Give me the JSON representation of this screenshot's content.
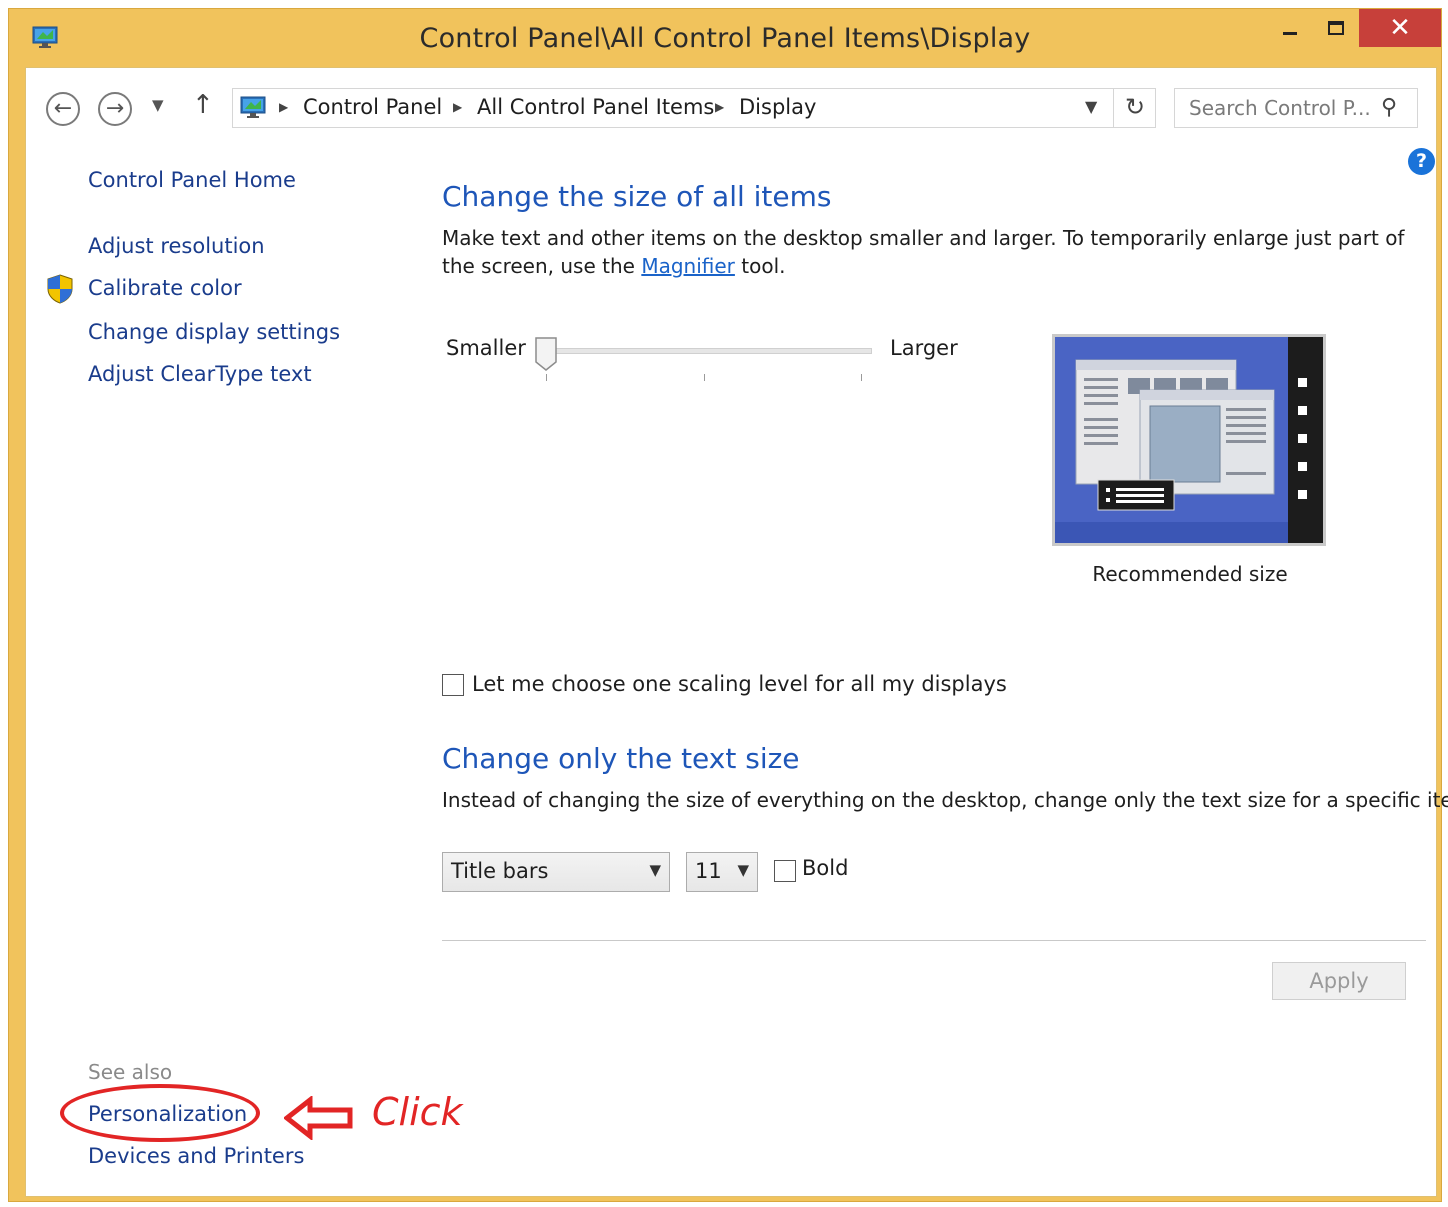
{
  "window": {
    "title": "Control Panel\\All Control Panel Items\\Display",
    "close_glyph": "✕"
  },
  "nav": {
    "breadcrumb": [
      "Control Panel",
      "All Control Panel Items",
      "Display"
    ],
    "search_placeholder": "Search Control P..."
  },
  "sidebar": {
    "home": "Control Panel Home",
    "links": [
      "Adjust resolution",
      "Calibrate color",
      "Change display settings",
      "Adjust ClearType text"
    ],
    "see_also_label": "See also",
    "see_also": [
      "Personalization",
      "Devices and Printers"
    ]
  },
  "annotation": {
    "text": "Click",
    "color": "#e22525"
  },
  "section_size": {
    "heading": "Change the size of all items",
    "desc_before": "Make text and other items on the desktop smaller and larger. To temporarily enlarge just part of the screen, use the ",
    "link": "Magnifier",
    "desc_after": " tool.",
    "slider_min_label": "Smaller",
    "slider_max_label": "Larger",
    "slider_level": 0,
    "preview_caption": "Recommended size"
  },
  "scaling_checkbox": {
    "label": "Let me choose one scaling level for all my displays",
    "checked": false
  },
  "section_text": {
    "heading": "Change only the text size",
    "desc": "Instead of changing the size of everything on the desktop, change only the text size for a specific item.",
    "item_selected": "Title bars",
    "size_selected": "11",
    "bold_label": "Bold",
    "bold_checked": false
  },
  "apply_label": "Apply",
  "colors": {
    "title_bar": "#f1c35c",
    "link": "#1a3c8c",
    "heading": "#1e56b8",
    "close": "#c7403a"
  }
}
